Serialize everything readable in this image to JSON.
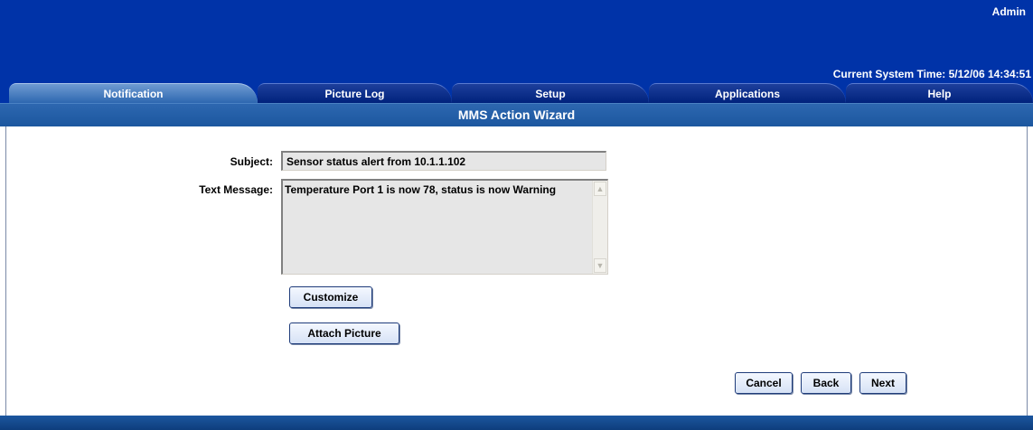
{
  "header": {
    "user": "Admin",
    "system_time": "Current System Time: 5/12/06 14:34:51"
  },
  "tabs": [
    {
      "label": "Notification",
      "active": true
    },
    {
      "label": "Picture Log",
      "active": false
    },
    {
      "label": "Setup",
      "active": false
    },
    {
      "label": "Applications",
      "active": false
    },
    {
      "label": "Help",
      "active": false
    }
  ],
  "wizard": {
    "title": "MMS Action Wizard"
  },
  "form": {
    "subject_label": "Subject:",
    "subject_value": "Sensor status alert from 10.1.1.102",
    "message_label": "Text Message:",
    "message_value": "Temperature Port 1 is now 78, status is now Warning"
  },
  "buttons": {
    "customize": "Customize",
    "attach_picture": "Attach Picture",
    "cancel": "Cancel",
    "back": "Back",
    "next": "Next"
  },
  "colors": {
    "header_bg": "#0033a8",
    "bar_bg": "#2d67b0",
    "field_bg": "#e6e6e6"
  }
}
